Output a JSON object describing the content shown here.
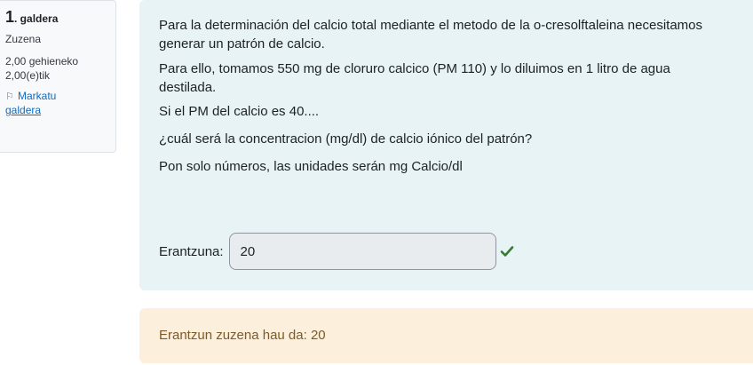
{
  "info": {
    "number": "1",
    "word": ". galdera",
    "state": "Zuzena",
    "grade_line1": "2,00 gehieneko",
    "grade_line2": "2,00(e)tik",
    "flag_line1": "Markatu",
    "flag_line2": "galdera",
    "flag_icon": "flag-icon"
  },
  "question": {
    "p1": "Para la determinación del calcio total mediante el metodo de la o-cresolftaleina necesitamos generar un patrón de calcio.",
    "p2": "Para ello, tomamos 550 mg de cloruro calcico (PM 110) y lo diluimos en 1 litro de agua destilada.",
    "p3": "Si el PM del calcio es 40....",
    "p4": "¿cuál será la concentracion (mg/dl) de calcio iónico del patrón?",
    "p5": "Pon solo números, las unidades serán mg Calcio/dl",
    "answer_label": "Erantzuna:",
    "answer_value": "20",
    "result_icon": "check-icon"
  },
  "feedback": {
    "text": "Erantzun zuzena hau da: 20"
  },
  "colors": {
    "formulation_bg": "#e7f3f5",
    "feedback_bg": "#fcefdc",
    "feedback_text": "#7d5a29",
    "check": "#357a32",
    "link": "#0f6cbf"
  }
}
